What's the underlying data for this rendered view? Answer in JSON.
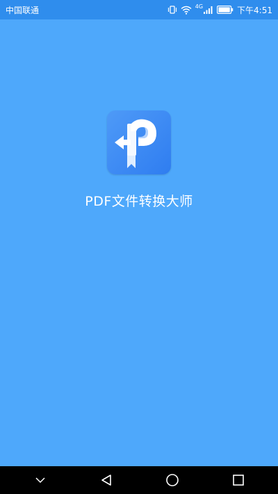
{
  "status_bar": {
    "carrier": "中国联通",
    "network_type": "4G",
    "time": "下午4:51"
  },
  "splash": {
    "app_name": "PDF文件转换大师",
    "icon": "pdf-converter-logo-icon"
  },
  "nav_bar": {
    "buttons": [
      "chevron-down-icon",
      "back-icon",
      "home-icon",
      "recents-icon"
    ]
  },
  "colors": {
    "background": "#4ea8fb",
    "status_bar": "#2f8ded",
    "icon_bg": "#3a88f2",
    "nav_bar": "#000000",
    "text": "#ffffff"
  }
}
